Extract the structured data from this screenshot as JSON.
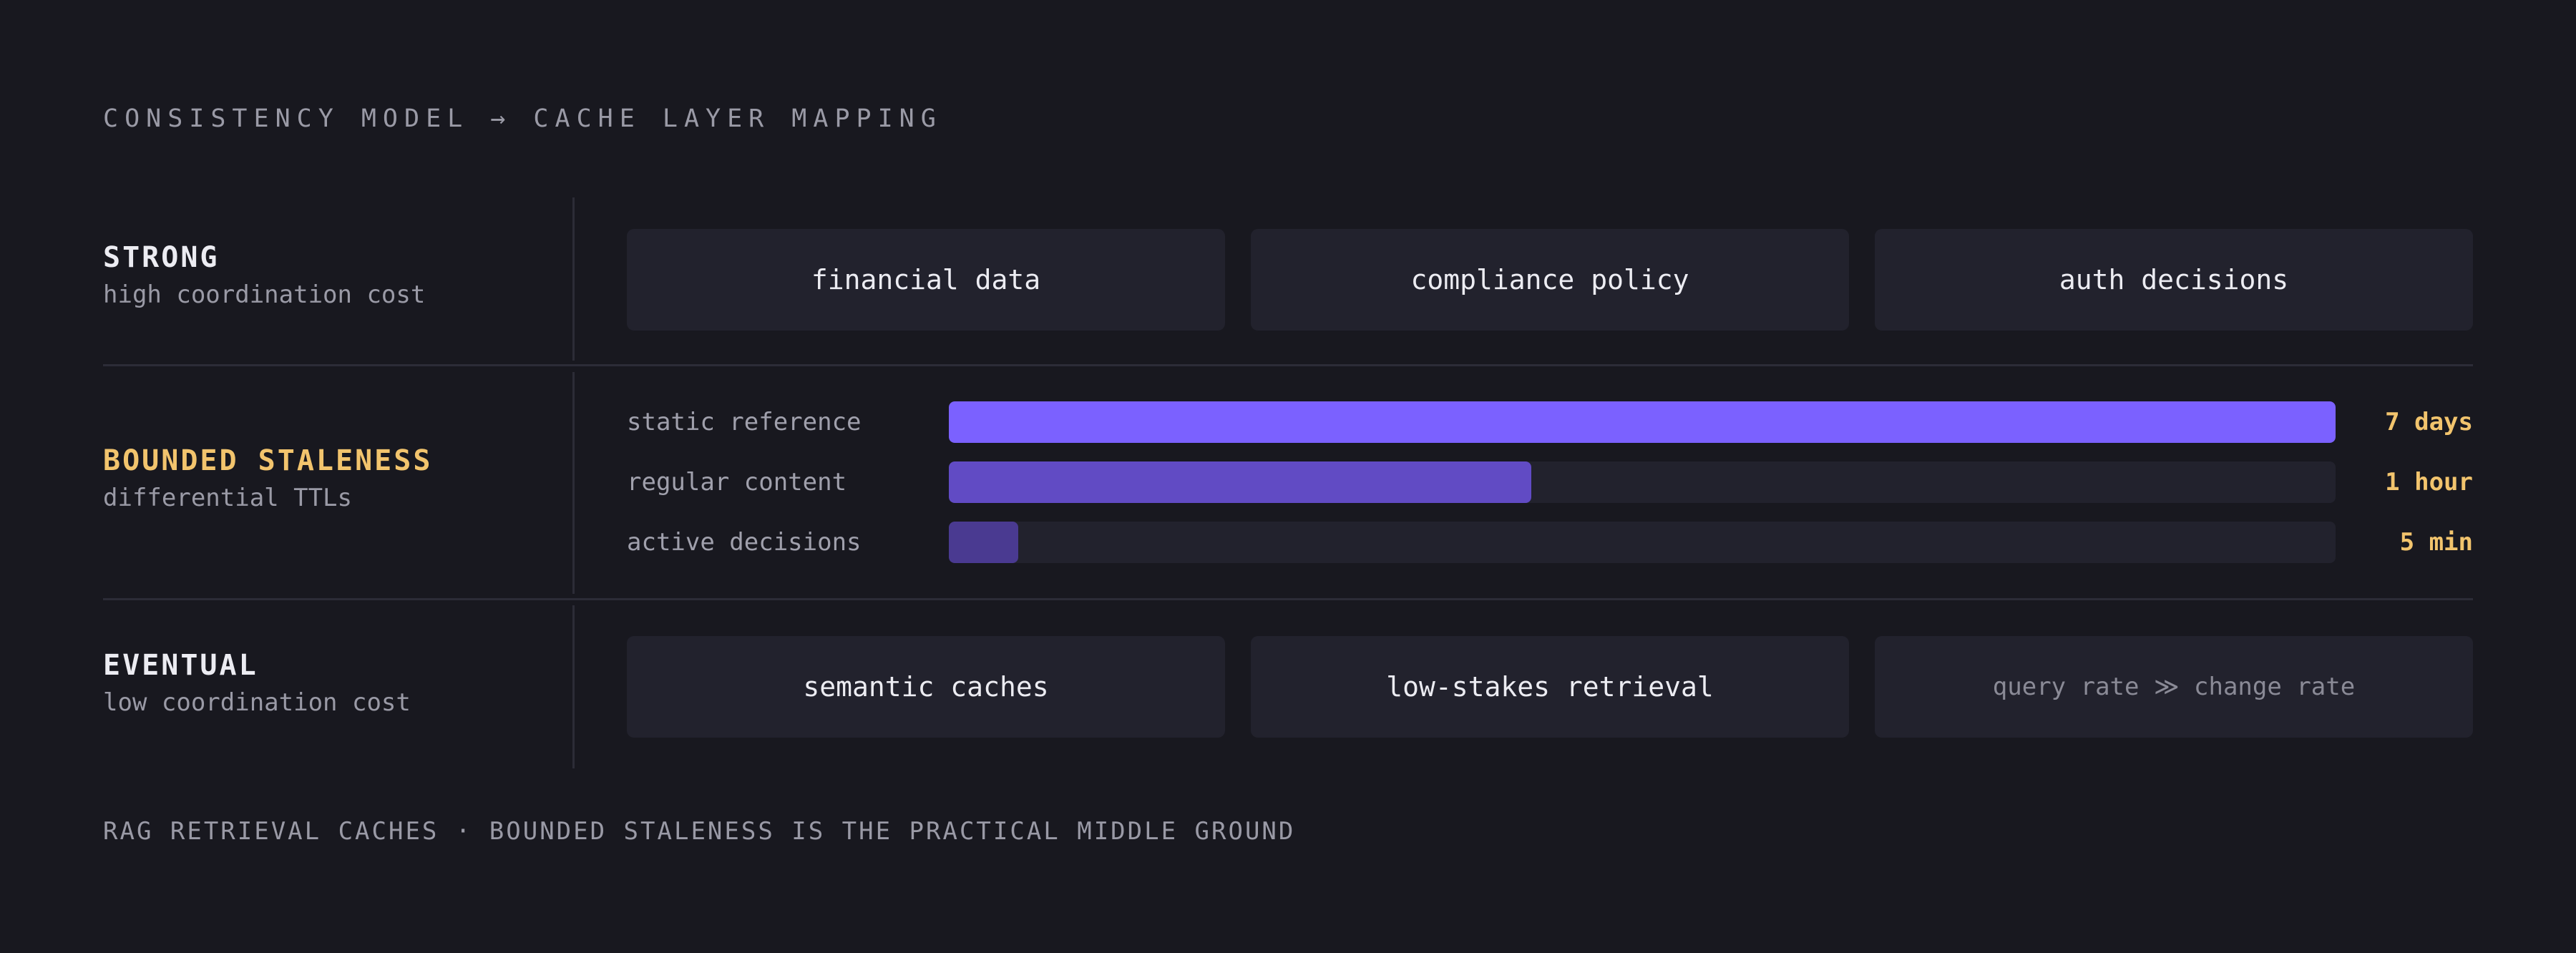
{
  "title": "CONSISTENCY MODEL → CACHE LAYER MAPPING",
  "colors": {
    "background": "#18181f",
    "accent": "#7b61ff",
    "highlight": "#f2c46d",
    "card": "#22222d"
  },
  "rows": {
    "strong": {
      "name": "STRONG",
      "subtitle": "high coordination cost",
      "cards": [
        "financial data",
        "compliance policy",
        "auth decisions"
      ]
    },
    "bounded": {
      "name": "BOUNDED STALENESS",
      "subtitle": "differential TTLs",
      "ttls": [
        {
          "label": "static reference",
          "value": "7 days",
          "level": 1.0,
          "color": "#7b61ff"
        },
        {
          "label": "regular content",
          "value": "1 hour",
          "level": 0.42,
          "color": "#614bc4"
        },
        {
          "label": "active decisions",
          "value": "5 min",
          "level": 0.05,
          "color": "#4a3a91"
        }
      ]
    },
    "eventual": {
      "name": "EVENTUAL",
      "subtitle": "low coordination cost",
      "cards": [
        "semantic caches",
        "low-stakes retrieval",
        "query rate ≫ change rate"
      ]
    }
  },
  "footer": "RAG RETRIEVAL CACHES · BOUNDED STALENESS IS THE PRACTICAL MIDDLE GROUND"
}
